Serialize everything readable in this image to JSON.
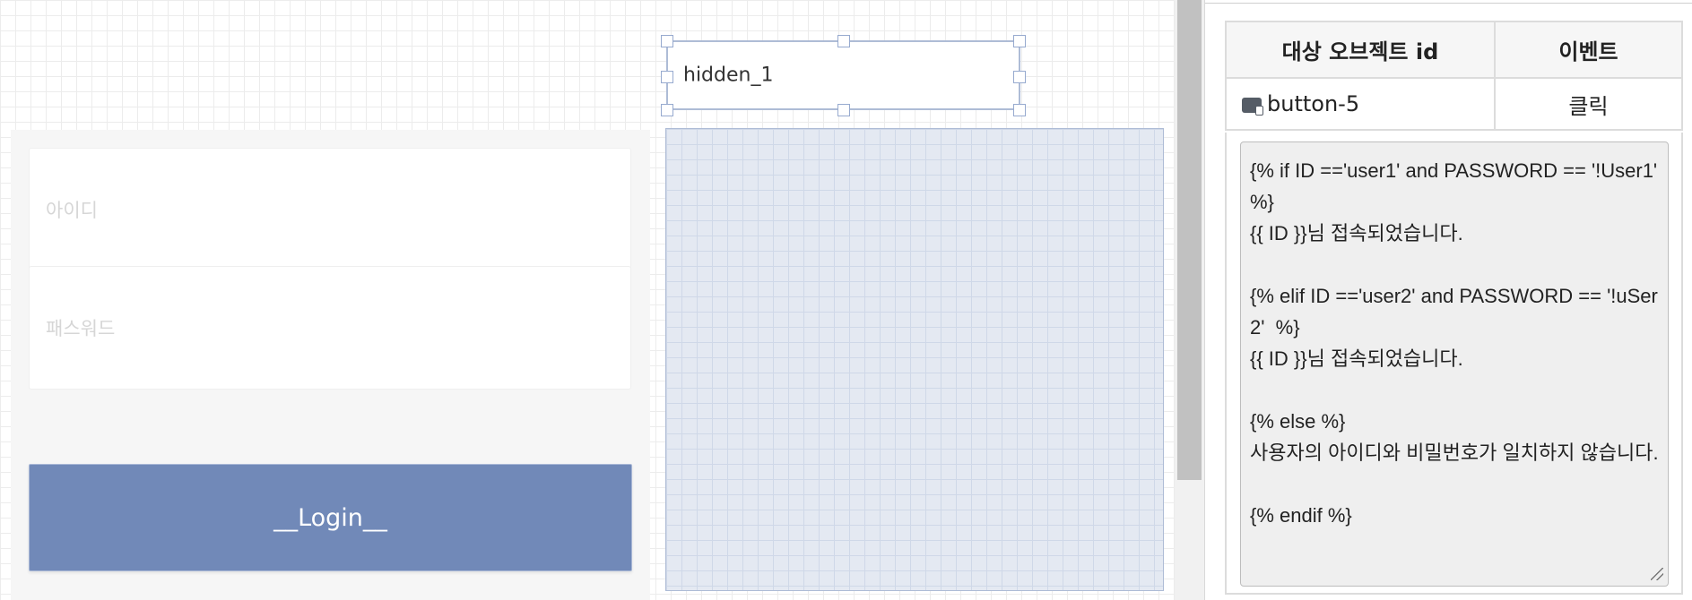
{
  "canvas": {
    "hidden_element_label": "hidden_1",
    "login_form": {
      "id_placeholder": "아이디",
      "password_placeholder": "패스워드",
      "login_button_label": "__Login__"
    }
  },
  "event_panel": {
    "table": {
      "columns": [
        "대상 오브젝트 id",
        "이벤트"
      ],
      "rows": [
        {
          "object_id": "button-5",
          "object_icon": "button-icon",
          "event": "클릭"
        }
      ]
    },
    "script_text": "{% if ID =='user1' and PASSWORD == '!User1' %}\n{{ ID }}님 접속되었습니다.\n\n{% elif ID =='user2' and PASSWORD == '!uSer2'  %}\n{{ ID }}님 접속되었습니다.\n\n{% else %}\n사용자의 아이디와 비밀번호가 일치하지 않습니다.\n\n{% endif %}"
  },
  "colors": {
    "login_button": "#7189b8",
    "selection_handle": "#97aacf",
    "drop_area": "#e4e9f2"
  }
}
